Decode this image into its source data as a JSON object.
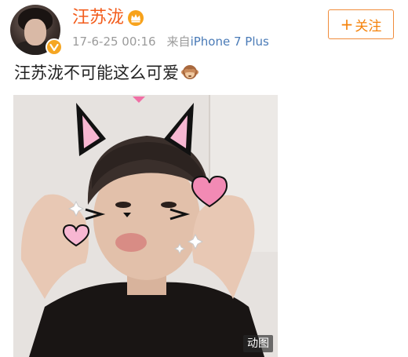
{
  "post": {
    "author": {
      "name": "汪苏泷",
      "avatar": "avatar-photo",
      "verified": true,
      "verified_color": "#f5a623",
      "member_badge": "crown-icon"
    },
    "time": "17-6-25 00:16",
    "source_prefix": "来自",
    "source": "iPhone 7 Plus",
    "follow_button": {
      "plus": "+",
      "label": "关注"
    },
    "text": "汪苏泷不可能这么可爱",
    "emoji": "monkey-see-no-evil-icon",
    "media": {
      "type": "gif",
      "badge": "动图",
      "description_icon": "cat-ear-filter-photo"
    }
  },
  "colors": {
    "username": "#f35c1c",
    "follow": "#f5820a",
    "meta": "#9b9b9b",
    "source_link": "#4a7bb7",
    "text": "#222222"
  }
}
